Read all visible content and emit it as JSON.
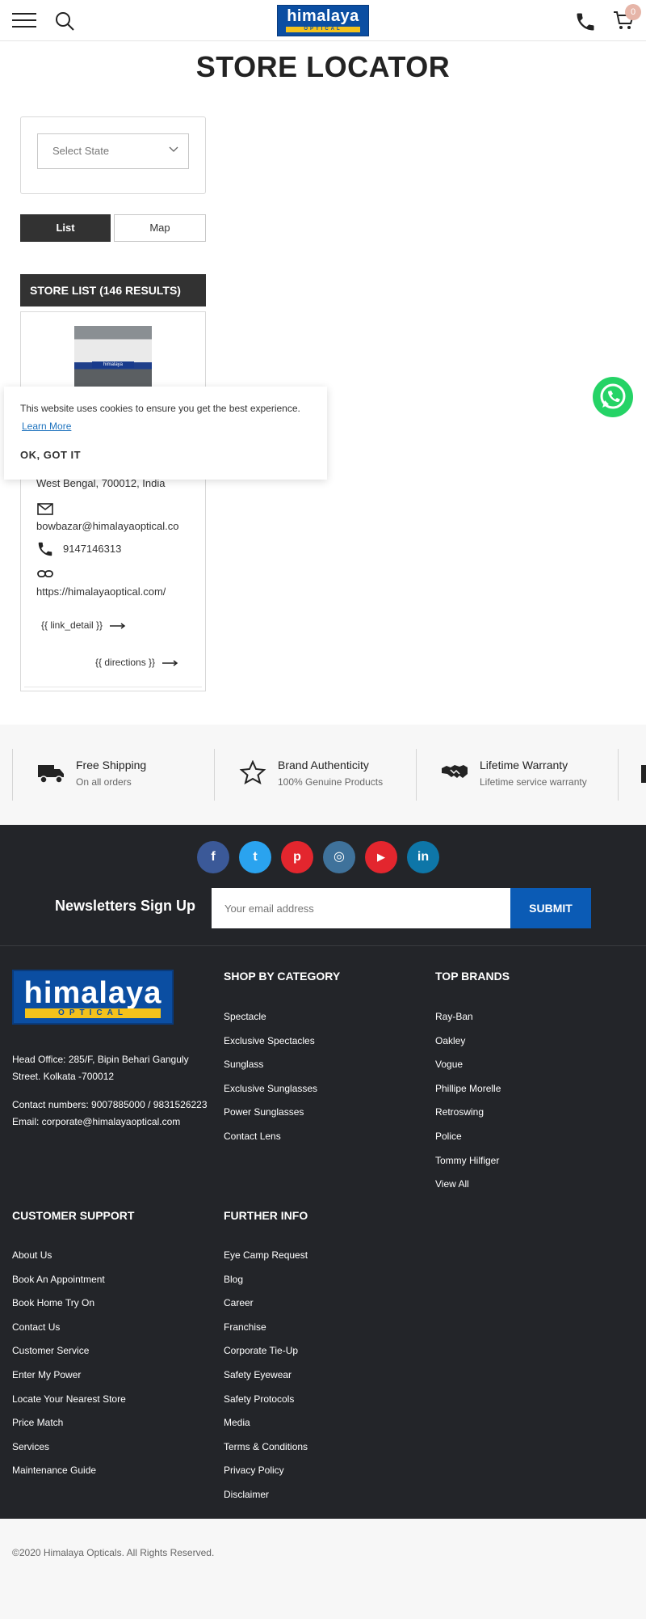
{
  "header": {
    "logo_text": "himalaya",
    "logo_sub": "OPTICAL",
    "cart_count": "0"
  },
  "page": {
    "title": "STORE LOCATOR"
  },
  "filters": {
    "state_placeholder": "Select State",
    "tab_list": "List",
    "tab_map": "Map"
  },
  "store_list": {
    "header": "STORE LIST (146 RESULTS)",
    "store": {
      "image_sign": "himalaya",
      "address_partial": "West Bengal, 700012, India",
      "email": "bowbazar@himalayaoptical.co",
      "phone": "9147146313",
      "website": "https://himalayaoptical.com/",
      "link_detail": "{{ link_detail }}",
      "directions": "{{ directions }}"
    }
  },
  "cookie": {
    "message": "This website uses cookies to ensure you get the best experience.",
    "learn_more": "Learn More",
    "ok": "OK, GOT IT"
  },
  "features": [
    {
      "title": "Free Shipping",
      "subtitle": "On all orders",
      "icon": "truck-icon"
    },
    {
      "title": "Brand Authenticity",
      "subtitle": "100% Genuine Products",
      "icon": "star-icon"
    },
    {
      "title": "Lifetime Warranty",
      "subtitle": "Lifetime service warranty",
      "icon": "handshake-icon"
    }
  ],
  "social": [
    {
      "name": "facebook",
      "glyph": "f",
      "color": "#3b5998"
    },
    {
      "name": "twitter",
      "glyph": "t",
      "color": "#2aa3ef"
    },
    {
      "name": "pinterest",
      "glyph": "p",
      "color": "#e3262e"
    },
    {
      "name": "instagram",
      "glyph": "◎",
      "color": "#3f729b"
    },
    {
      "name": "youtube",
      "glyph": "▶",
      "color": "#e3262e"
    },
    {
      "name": "linkedin",
      "glyph": "in",
      "color": "#0e76a8"
    }
  ],
  "newsletter": {
    "label": "Newsletters Sign Up",
    "placeholder": "Your email address",
    "submit": "SUBMIT"
  },
  "footer": {
    "logo_text": "himalaya",
    "logo_sub": "OPTICAL",
    "head_office_1": "Head Office: 285/F, Bipin Behari Ganguly",
    "head_office_2": "Street. Kolkata -700012",
    "contact": "Contact numbers: 9007885000 / 9831526223",
    "email": "Email: corporate@himalayaoptical.com",
    "shop_by_category": {
      "heading": "SHOP BY CATEGORY",
      "items": [
        "Spectacle",
        "Exclusive Spectacles",
        "Sunglass",
        "Exclusive Sunglasses",
        "Power Sunglasses",
        "Contact Lens"
      ]
    },
    "top_brands": {
      "heading": "TOP BRANDS",
      "items": [
        "Ray-Ban",
        "Oakley",
        "Vogue",
        "Phillipe Morelle",
        "Retroswing",
        "Police",
        "Tommy Hilfiger",
        "View All"
      ]
    },
    "customer_support": {
      "heading": "CUSTOMER SUPPORT",
      "items": [
        "About Us",
        "Book An Appointment",
        "Book Home Try On",
        "Contact Us",
        "Customer Service",
        "Enter My Power",
        "Locate Your Nearest Store",
        "Price Match",
        "Services",
        "Maintenance Guide"
      ]
    },
    "further_info": {
      "heading": "FURTHER INFO",
      "items": [
        "Eye Camp Request",
        "Blog",
        "Career",
        "Franchise",
        "Corporate Tie-Up",
        "Safety Eyewear",
        "Safety Protocols",
        "Media",
        "Terms & Conditions",
        "Privacy Policy",
        "Disclaimer"
      ]
    },
    "copyright": "©2020 Himalaya Opticals. All Rights Reserved."
  }
}
